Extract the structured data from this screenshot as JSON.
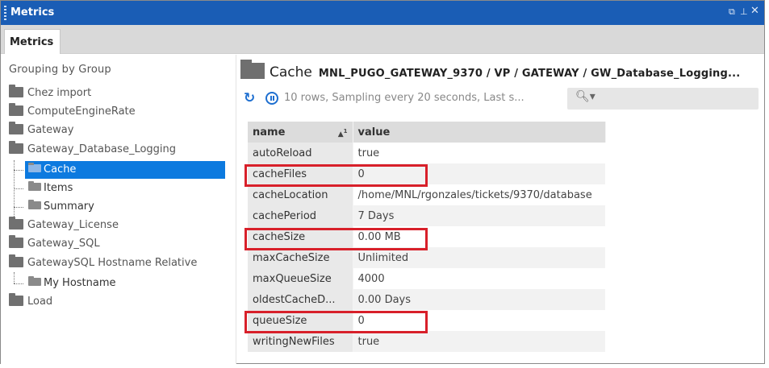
{
  "window": {
    "title": "Metrics",
    "controls": [
      "restore-icon",
      "pin-icon",
      "close-icon"
    ]
  },
  "tabs": [
    {
      "label": "Metrics",
      "active": true
    }
  ],
  "left": {
    "group_header": "Grouping by Group",
    "tree": [
      {
        "label": "Chez import",
        "level": 0
      },
      {
        "label": "ComputeEngineRate",
        "level": 0
      },
      {
        "label": "Gateway",
        "level": 0
      },
      {
        "label": "Gateway_Database_Logging",
        "level": 0,
        "expanded": true
      },
      {
        "label": "Cache",
        "level": 1,
        "selected": true
      },
      {
        "label": "Items",
        "level": 1
      },
      {
        "label": "Summary",
        "level": 1
      },
      {
        "label": "Gateway_License",
        "level": 0
      },
      {
        "label": "Gateway_SQL",
        "level": 0
      },
      {
        "label": "GatewaySQL Hostname Relative",
        "level": 0,
        "expanded": true
      },
      {
        "label": "My Hostname",
        "level": 1
      },
      {
        "label": "Load",
        "level": 0
      }
    ]
  },
  "main": {
    "title": "Cache",
    "path": "MNL_PUGO_GATEWAY_9370 / VP / GATEWAY / GW_Database_Logging...",
    "status": "10 rows, Sampling every 20 seconds, Last s...",
    "search": {
      "placeholder": "",
      "value": ""
    },
    "table": {
      "columns": [
        "name",
        "value"
      ],
      "sort": {
        "column": "name",
        "direction": "asc",
        "order": "1"
      },
      "rows": [
        {
          "name": "autoReload",
          "value": "true"
        },
        {
          "name": "cacheFiles",
          "value": "0",
          "highlighted": true
        },
        {
          "name": "cacheLocation",
          "value": "/home/MNL/rgonzales/tickets/9370/database"
        },
        {
          "name": "cachePeriod",
          "value": "7 Days"
        },
        {
          "name": "cacheSize",
          "value": "0.00 MB",
          "highlighted": true
        },
        {
          "name": "maxCacheSize",
          "value": "Unlimited"
        },
        {
          "name": "maxQueueSize",
          "value": "4000"
        },
        {
          "name": "oldestCacheD...",
          "value": "0.00 Days"
        },
        {
          "name": "queueSize",
          "value": "0",
          "highlighted": true
        },
        {
          "name": "writingNewFiles",
          "value": "true"
        }
      ]
    }
  },
  "colors": {
    "titlebar": "#1a5db5",
    "selection": "#0d7adf",
    "highlight": "#d8202a",
    "accent": "#1e6fd0"
  }
}
